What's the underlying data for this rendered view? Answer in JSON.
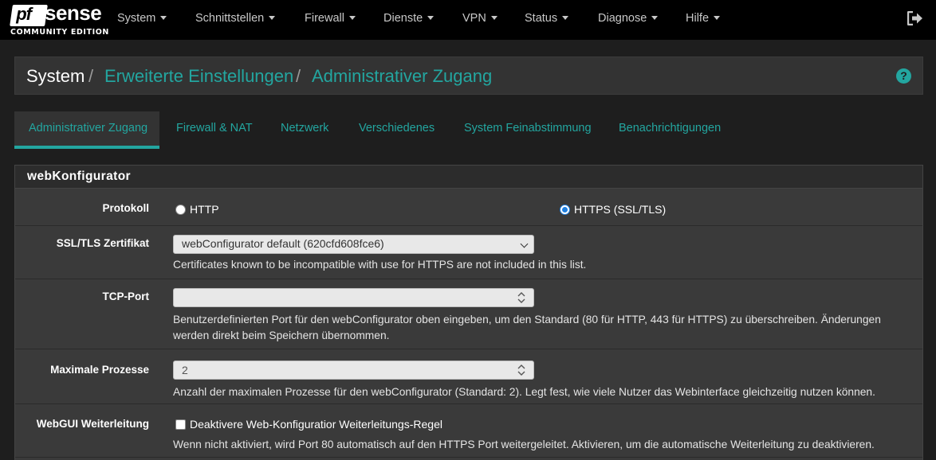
{
  "brand": {
    "logo_mark": "pf",
    "logo_word": "sense",
    "edition": "COMMUNITY EDITION"
  },
  "nav": {
    "items": [
      "System",
      "Schnittstellen",
      "Firewall",
      "Dienste",
      "VPN",
      "Status",
      "Diagnose",
      "Hilfe"
    ]
  },
  "breadcrumb": {
    "root": "System",
    "sep": "/",
    "level1": "Erweiterte Einstellungen",
    "level2": "Administrativer Zugang"
  },
  "tabs": [
    "Administrativer Zugang",
    "Firewall & NAT",
    "Netzwerk",
    "Verschiedenes",
    "System Feinabstimmung",
    "Benachrichtigungen"
  ],
  "panel": {
    "title": "webKonfigurator",
    "protocol": {
      "label": "Protokoll",
      "option_http": "HTTP",
      "option_https": "HTTPS (SSL/TLS)",
      "selected": "HTTPS (SSL/TLS)"
    },
    "certificate": {
      "label": "SSL/TLS Zertifikat",
      "value": "webConfigurator default (620cfd608fce6)",
      "help": "Certificates known to be incompatible with use for HTTPS are not included in this list."
    },
    "tcp_port": {
      "label": "TCP-Port",
      "value": "",
      "help": "Benutzerdefinierten Port für den webConfigurator oben eingeben, um den Standard (80 für HTTP, 443 für HTTPS) zu überschreiben. Änderungen werden direkt beim Speichern übernommen."
    },
    "max_processes": {
      "label": "Maximale Prozesse",
      "value": "2",
      "help": "Anzahl der maximalen Prozesse für den webConfigurator (Standard: 2). Legt fest, wie viele Nutzer das Webinterface gleichzeitig nutzen können."
    },
    "webgui_redirect": {
      "label": "WebGUI Weiterleitung",
      "checkbox_label": "Deaktivere Web-Konfiguratior Weiterleitungs-Regel",
      "checked": false,
      "help": "Wenn nicht aktiviert, wird Port 80 automatisch auf den HTTPS Port weitergeleitet. Aktivieren, um die automatische Weiterleitung zu deaktivieren."
    }
  },
  "colors": {
    "accent": "#23a6a0",
    "navbar": "#000000",
    "panel": "#3a3a3a"
  }
}
